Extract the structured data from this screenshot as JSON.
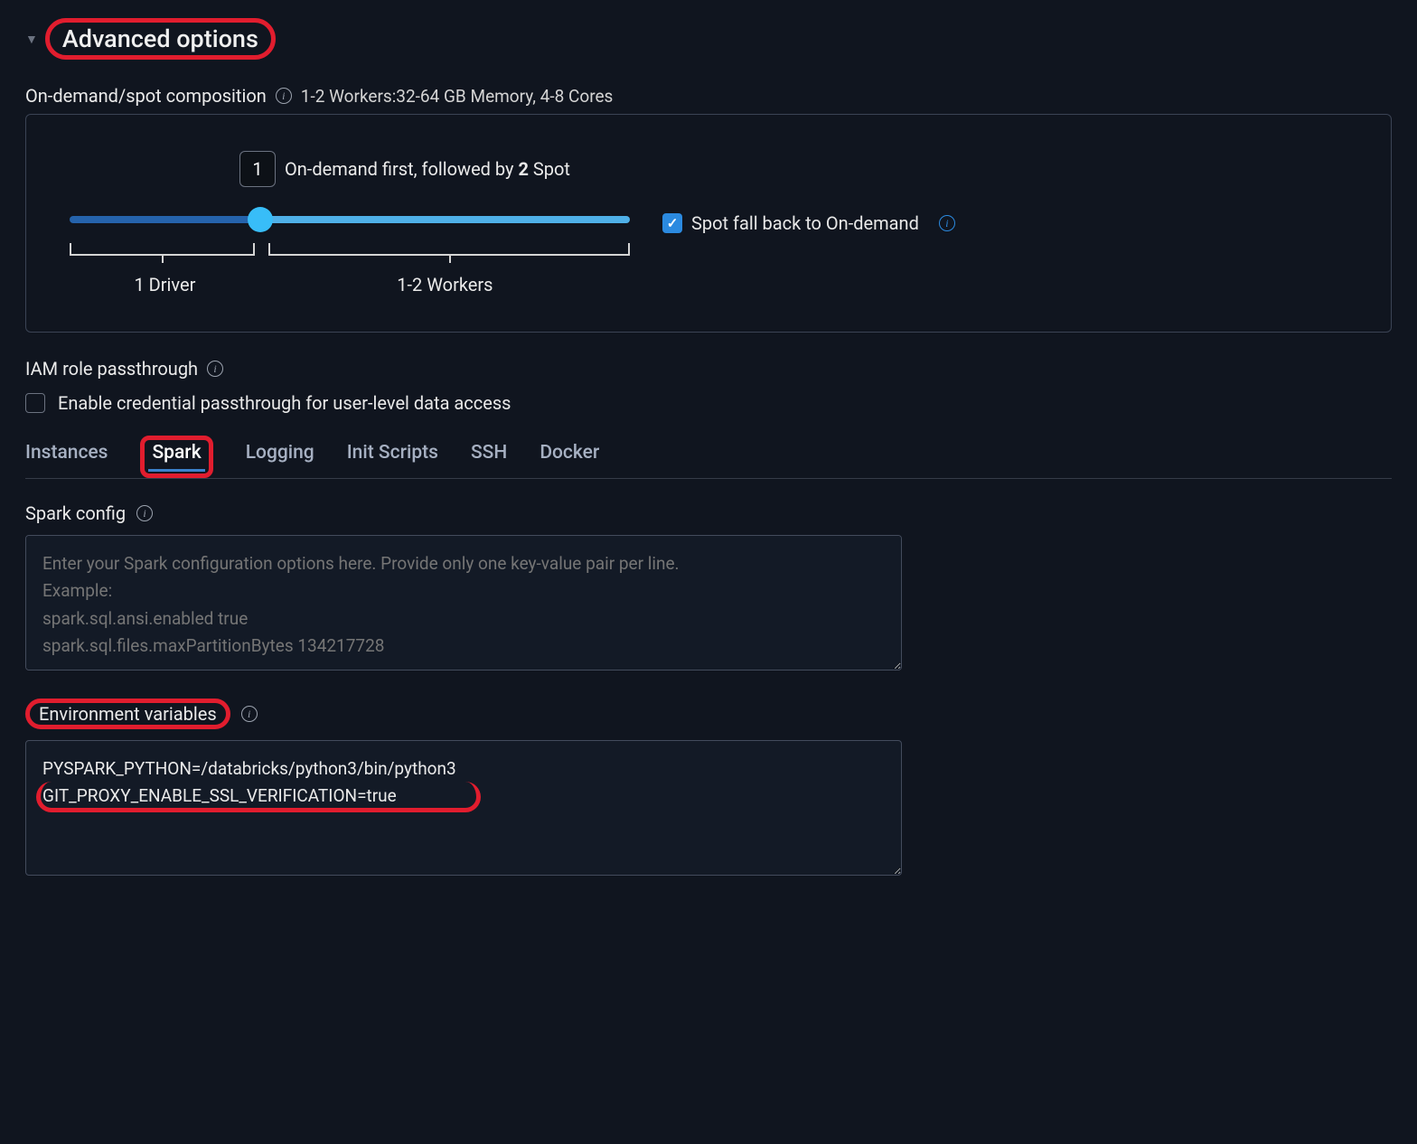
{
  "header": {
    "title": "Advanced options"
  },
  "composition": {
    "label": "On-demand/spot composition",
    "summary": "1-2 Workers:32-64 GB Memory, 4-8 Cores",
    "slider_value": "1",
    "slider_desc_prefix": "On-demand first, followed by ",
    "slider_desc_bold": "2",
    "slider_desc_suffix": " Spot",
    "driver_label": "1 Driver",
    "workers_label": "1-2 Workers",
    "spot_fallback_label": "Spot fall back to On-demand"
  },
  "iam": {
    "label": "IAM role passthrough",
    "checkbox_label": "Enable credential passthrough for user-level data access"
  },
  "tabs": {
    "instances": "Instances",
    "spark": "Spark",
    "logging": "Logging",
    "init_scripts": "Init Scripts",
    "ssh": "SSH",
    "docker": "Docker"
  },
  "spark_config": {
    "label": "Spark config",
    "placeholder": "Enter your Spark configuration options here. Provide only one key-value pair per line.\nExample:\nspark.sql.ansi.enabled true\nspark.sql.files.maxPartitionBytes 134217728"
  },
  "env": {
    "label": "Environment variables",
    "value": "PYSPARK_PYTHON=/databricks/python3/bin/python3\nGIT_PROXY_ENABLE_SSL_VERIFICATION=true"
  }
}
